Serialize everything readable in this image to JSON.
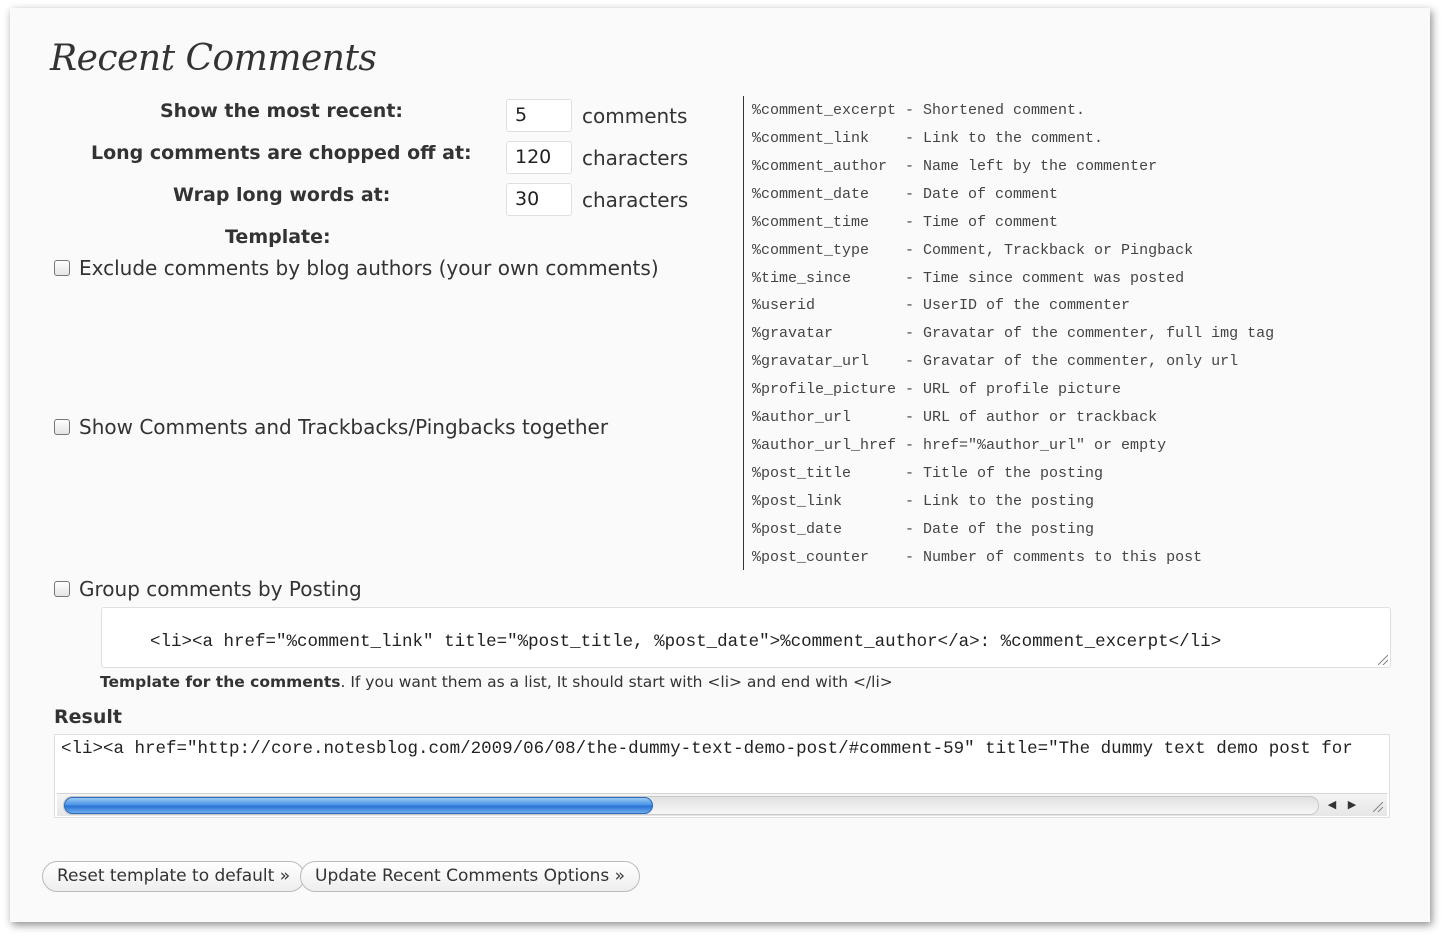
{
  "title": "Recent Comments",
  "fields": {
    "most_recent": {
      "label": "Show the most recent:",
      "value": "5",
      "unit": "comments"
    },
    "chop": {
      "label": "Long comments are chopped off at:",
      "value": "120",
      "unit": "characters"
    },
    "wrap": {
      "label": "Wrap long words at:",
      "value": "30",
      "unit": "characters"
    },
    "template_label": "Template:"
  },
  "checkboxes": {
    "exclude_authors": {
      "label": "Exclude comments by blog authors (your own comments)",
      "checked": false
    },
    "show_together": {
      "label": "Show Comments and Trackbacks/Pingbacks together",
      "checked": false
    },
    "group_by_posting": {
      "label": "Group comments by Posting",
      "checked": false
    }
  },
  "placeholders": [
    {
      "text": "%comment_excerpt - Shortened comment."
    },
    {
      "text": "%comment_link    - Link to the comment."
    },
    {
      "text": "%comment_author  - Name left by the commenter"
    },
    {
      "text": "%comment_date    - Date of comment"
    },
    {
      "text": "%comment_time    - Time of comment"
    },
    {
      "text": "%comment_type    - Comment, Trackback or Pingback"
    },
    {
      "text": "%time_since      - Time since comment was posted"
    },
    {
      "text": "%userid          - UserID of the commenter"
    },
    {
      "text": "%gravatar        - Gravatar of the commenter, full img tag"
    },
    {
      "text": "%gravatar_url    - Gravatar of the commenter, only url"
    },
    {
      "text": "%profile_picture - URL of profile picture"
    },
    {
      "text": "%author_url      - URL of author or trackback"
    },
    {
      "text": "%author_url_href - href=\"%author_url\" or empty"
    },
    {
      "text": "%post_title      - Title of the posting"
    },
    {
      "text": "%post_link       - Link to the posting"
    },
    {
      "text": "%post_date       - Date of the posting"
    },
    {
      "text": "%post_counter    - Number of comments to this post"
    }
  ],
  "template": {
    "value": "<li><a href=\"%comment_link\" title=\"%post_title, %post_date\">%comment_author</a>: %comment_excerpt</li>",
    "help_bold": "Template for the comments",
    "help_rest": ". If you want them as a list, It should start with <li> and end with </li>"
  },
  "result": {
    "label": "Result",
    "value": "<li><a href=\"http://core.notesblog.com/2009/06/08/the-dummy-text-demo-post/#comment-59\" title=\"The dummy text demo post for",
    "scroll_fraction": 0.47
  },
  "icons": {
    "left_arrow": "◀",
    "right_arrow": "▶"
  },
  "buttons": {
    "reset": "Reset template to default »",
    "update": "Update Recent Comments Options »"
  }
}
